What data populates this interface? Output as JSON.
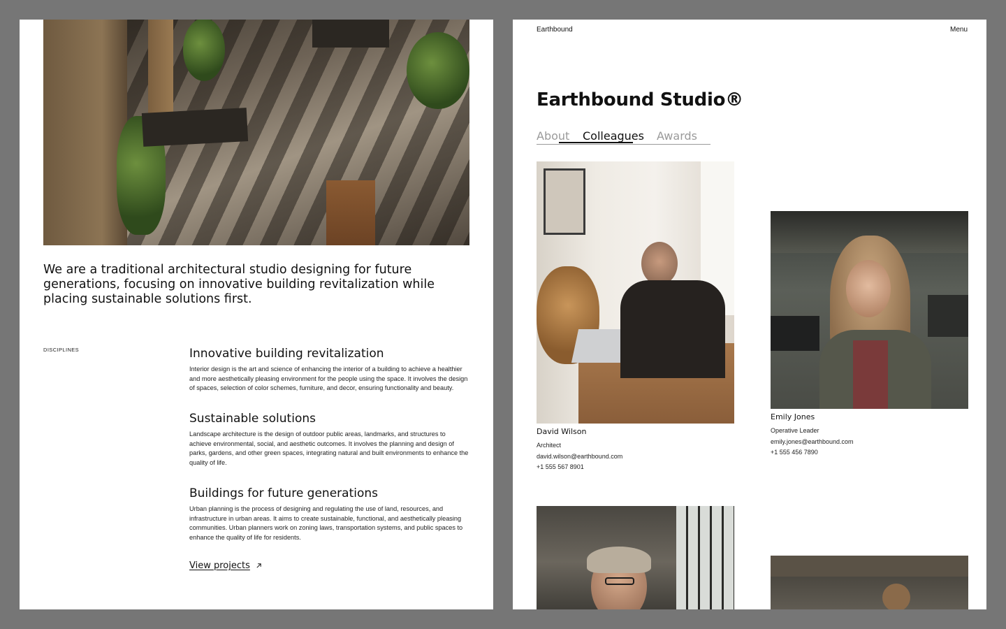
{
  "left": {
    "intro": "We are a traditional architectural studio designing for future generations, focusing on innovative building revitalization while placing sustainable solutions first.",
    "disciplines_label": "DISCIPLINES",
    "disciplines": [
      {
        "title": "Innovative building revitalization",
        "text": "Interior design is the art and science of enhancing the interior of a building to achieve a healthier and more aesthetically pleasing environment for the people using the space. It involves the design of spaces, selection of color schemes, furniture, and decor, ensuring functionality and beauty."
      },
      {
        "title": "Sustainable solutions",
        "text": "Landscape architecture is the design of outdoor public areas, landmarks, and structures to achieve environmental, social, and aesthetic outcomes. It involves the planning and design of parks, gardens, and other green spaces, integrating natural and built environments to enhance the quality of life."
      },
      {
        "title": "Buildings for future generations",
        "text": "Urban planning is the process of designing and regulating the use of land, resources, and infrastructure in urban areas. It aims to create sustainable, functional, and aesthetically pleasing communities. Urban planners work on zoning laws, transportation systems, and public spaces to enhance the quality of life for residents."
      }
    ],
    "view_projects": "View projects"
  },
  "right": {
    "brand": "Earthbound",
    "menu": "Menu",
    "title": "Earthbound Studio®",
    "tabs": [
      {
        "label": "About"
      },
      {
        "label": "Colleagues"
      },
      {
        "label": "Awards"
      }
    ],
    "active_tab": "Colleagues",
    "colleagues": [
      {
        "name": "David Wilson",
        "role": "Architect",
        "email": "david.wilson@earthbound.com",
        "phone": "+1 555 567 8901"
      },
      {
        "name": "Emily Jones",
        "role": "Operative Leader",
        "email": "emily.jones@earthbound.com",
        "phone": "+1 555 456 7890"
      }
    ]
  }
}
